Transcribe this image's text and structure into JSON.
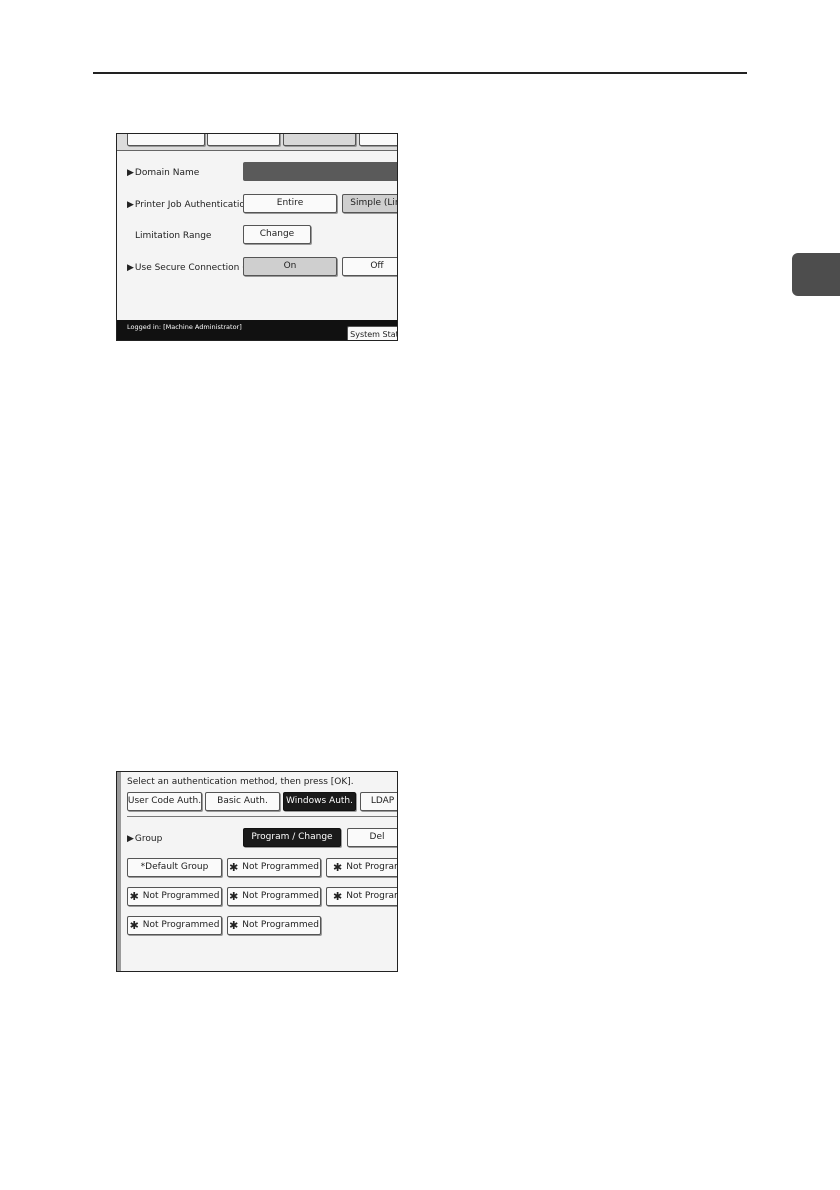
{
  "screen1": {
    "labels": {
      "domain_name": "Domain Name",
      "printer_job_auth": "Printer Job Authentication",
      "limitation_range": "Limitation Range",
      "use_ssl": "Use Secure Connection (SSL)"
    },
    "buttons": {
      "entire": "Entire",
      "simple": "Simple (Lim",
      "change": "Change",
      "on": "On",
      "off": "Off"
    },
    "status": {
      "logged_in": "Logged in:  [Machine Administrator]",
      "system_status": "System Statu"
    }
  },
  "screen2": {
    "instruction": "Select an authentication method, then press [OK].",
    "tabs": [
      "User Code Auth.",
      "Basic Auth.",
      "Windows Auth.",
      "LDAP"
    ],
    "group_label": "Group",
    "program_change": "Program / Change",
    "delete": "Del",
    "star": "✱",
    "default_group": "*Default Group",
    "not_programmed": "Not Programmed",
    "not_programmed_cut": "Not Programm"
  }
}
